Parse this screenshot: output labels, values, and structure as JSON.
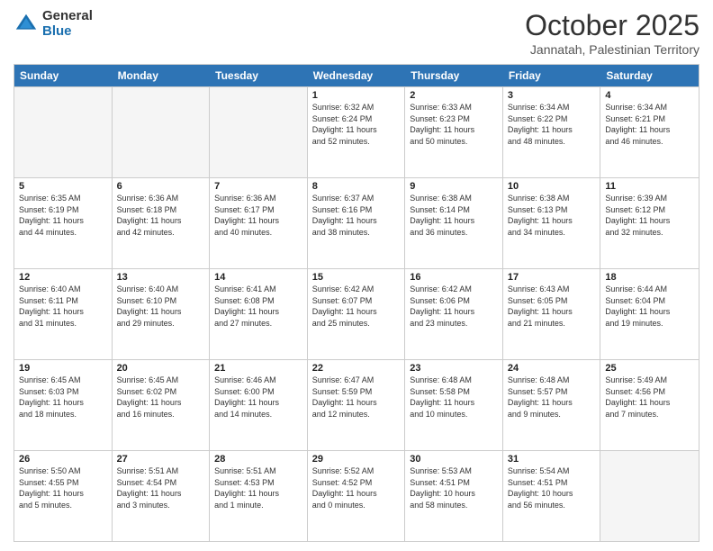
{
  "logo": {
    "general": "General",
    "blue": "Blue"
  },
  "header": {
    "month": "October 2025",
    "location": "Jannatah, Palestinian Territory"
  },
  "weekdays": [
    "Sunday",
    "Monday",
    "Tuesday",
    "Wednesday",
    "Thursday",
    "Friday",
    "Saturday"
  ],
  "weeks": [
    [
      {
        "day": "",
        "text": "",
        "empty": true
      },
      {
        "day": "",
        "text": "",
        "empty": true
      },
      {
        "day": "",
        "text": "",
        "empty": true
      },
      {
        "day": "1",
        "text": "Sunrise: 6:32 AM\nSunset: 6:24 PM\nDaylight: 11 hours\nand 52 minutes.",
        "empty": false
      },
      {
        "day": "2",
        "text": "Sunrise: 6:33 AM\nSunset: 6:23 PM\nDaylight: 11 hours\nand 50 minutes.",
        "empty": false
      },
      {
        "day": "3",
        "text": "Sunrise: 6:34 AM\nSunset: 6:22 PM\nDaylight: 11 hours\nand 48 minutes.",
        "empty": false
      },
      {
        "day": "4",
        "text": "Sunrise: 6:34 AM\nSunset: 6:21 PM\nDaylight: 11 hours\nand 46 minutes.",
        "empty": false
      }
    ],
    [
      {
        "day": "5",
        "text": "Sunrise: 6:35 AM\nSunset: 6:19 PM\nDaylight: 11 hours\nand 44 minutes.",
        "empty": false
      },
      {
        "day": "6",
        "text": "Sunrise: 6:36 AM\nSunset: 6:18 PM\nDaylight: 11 hours\nand 42 minutes.",
        "empty": false
      },
      {
        "day": "7",
        "text": "Sunrise: 6:36 AM\nSunset: 6:17 PM\nDaylight: 11 hours\nand 40 minutes.",
        "empty": false
      },
      {
        "day": "8",
        "text": "Sunrise: 6:37 AM\nSunset: 6:16 PM\nDaylight: 11 hours\nand 38 minutes.",
        "empty": false
      },
      {
        "day": "9",
        "text": "Sunrise: 6:38 AM\nSunset: 6:14 PM\nDaylight: 11 hours\nand 36 minutes.",
        "empty": false
      },
      {
        "day": "10",
        "text": "Sunrise: 6:38 AM\nSunset: 6:13 PM\nDaylight: 11 hours\nand 34 minutes.",
        "empty": false
      },
      {
        "day": "11",
        "text": "Sunrise: 6:39 AM\nSunset: 6:12 PM\nDaylight: 11 hours\nand 32 minutes.",
        "empty": false
      }
    ],
    [
      {
        "day": "12",
        "text": "Sunrise: 6:40 AM\nSunset: 6:11 PM\nDaylight: 11 hours\nand 31 minutes.",
        "empty": false
      },
      {
        "day": "13",
        "text": "Sunrise: 6:40 AM\nSunset: 6:10 PM\nDaylight: 11 hours\nand 29 minutes.",
        "empty": false
      },
      {
        "day": "14",
        "text": "Sunrise: 6:41 AM\nSunset: 6:08 PM\nDaylight: 11 hours\nand 27 minutes.",
        "empty": false
      },
      {
        "day": "15",
        "text": "Sunrise: 6:42 AM\nSunset: 6:07 PM\nDaylight: 11 hours\nand 25 minutes.",
        "empty": false
      },
      {
        "day": "16",
        "text": "Sunrise: 6:42 AM\nSunset: 6:06 PM\nDaylight: 11 hours\nand 23 minutes.",
        "empty": false
      },
      {
        "day": "17",
        "text": "Sunrise: 6:43 AM\nSunset: 6:05 PM\nDaylight: 11 hours\nand 21 minutes.",
        "empty": false
      },
      {
        "day": "18",
        "text": "Sunrise: 6:44 AM\nSunset: 6:04 PM\nDaylight: 11 hours\nand 19 minutes.",
        "empty": false
      }
    ],
    [
      {
        "day": "19",
        "text": "Sunrise: 6:45 AM\nSunset: 6:03 PM\nDaylight: 11 hours\nand 18 minutes.",
        "empty": false
      },
      {
        "day": "20",
        "text": "Sunrise: 6:45 AM\nSunset: 6:02 PM\nDaylight: 11 hours\nand 16 minutes.",
        "empty": false
      },
      {
        "day": "21",
        "text": "Sunrise: 6:46 AM\nSunset: 6:00 PM\nDaylight: 11 hours\nand 14 minutes.",
        "empty": false
      },
      {
        "day": "22",
        "text": "Sunrise: 6:47 AM\nSunset: 5:59 PM\nDaylight: 11 hours\nand 12 minutes.",
        "empty": false
      },
      {
        "day": "23",
        "text": "Sunrise: 6:48 AM\nSunset: 5:58 PM\nDaylight: 11 hours\nand 10 minutes.",
        "empty": false
      },
      {
        "day": "24",
        "text": "Sunrise: 6:48 AM\nSunset: 5:57 PM\nDaylight: 11 hours\nand 9 minutes.",
        "empty": false
      },
      {
        "day": "25",
        "text": "Sunrise: 5:49 AM\nSunset: 4:56 PM\nDaylight: 11 hours\nand 7 minutes.",
        "empty": false
      }
    ],
    [
      {
        "day": "26",
        "text": "Sunrise: 5:50 AM\nSunset: 4:55 PM\nDaylight: 11 hours\nand 5 minutes.",
        "empty": false
      },
      {
        "day": "27",
        "text": "Sunrise: 5:51 AM\nSunset: 4:54 PM\nDaylight: 11 hours\nand 3 minutes.",
        "empty": false
      },
      {
        "day": "28",
        "text": "Sunrise: 5:51 AM\nSunset: 4:53 PM\nDaylight: 11 hours\nand 1 minute.",
        "empty": false
      },
      {
        "day": "29",
        "text": "Sunrise: 5:52 AM\nSunset: 4:52 PM\nDaylight: 11 hours\nand 0 minutes.",
        "empty": false
      },
      {
        "day": "30",
        "text": "Sunrise: 5:53 AM\nSunset: 4:51 PM\nDaylight: 10 hours\nand 58 minutes.",
        "empty": false
      },
      {
        "day": "31",
        "text": "Sunrise: 5:54 AM\nSunset: 4:51 PM\nDaylight: 10 hours\nand 56 minutes.",
        "empty": false
      },
      {
        "day": "",
        "text": "",
        "empty": true
      }
    ]
  ]
}
